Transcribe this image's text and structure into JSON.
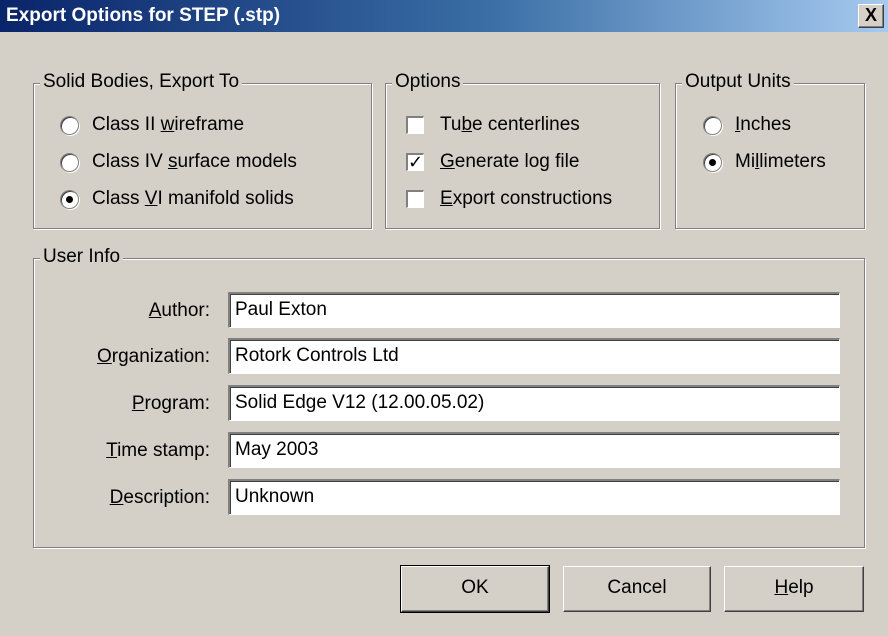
{
  "window": {
    "title": "Export Options for STEP (.stp)",
    "close_glyph": "X"
  },
  "solid_bodies": {
    "legend": "Solid Bodies, Export To",
    "options": [
      {
        "pre": "Class II ",
        "key": "w",
        "post": "ireframe",
        "selected": false
      },
      {
        "pre": "Class IV ",
        "key": "s",
        "post": "urface models",
        "selected": false
      },
      {
        "pre": "Class ",
        "key": "V",
        "post": "I manifold solids",
        "selected": true
      }
    ]
  },
  "options_group": {
    "legend": "Options",
    "items": [
      {
        "pre": "Tu",
        "key": "b",
        "post": "e centerlines",
        "checked": false
      },
      {
        "pre": "",
        "key": "G",
        "post": "enerate log file",
        "checked": true
      },
      {
        "pre": "",
        "key": "E",
        "post": "xport constructions",
        "checked": false
      }
    ]
  },
  "output_units": {
    "legend": "Output Units",
    "options": [
      {
        "pre": "",
        "key": "I",
        "post": "nches",
        "selected": false
      },
      {
        "pre": "Mi",
        "key": "l",
        "post": "limeters",
        "selected": true
      }
    ]
  },
  "user_info": {
    "legend": "User Info",
    "fields": [
      {
        "key": "A",
        "post": "uthor:",
        "value": "Paul Exton"
      },
      {
        "key": "O",
        "post": "rganization:",
        "value": "Rotork Controls Ltd"
      },
      {
        "key": "P",
        "post": "rogram:",
        "value": "Solid Edge V12 (12.00.05.02)"
      },
      {
        "key": "T",
        "post": "ime stamp:",
        "value": "May 2003"
      },
      {
        "key": "D",
        "post": "escription:",
        "value": "Unknown"
      }
    ]
  },
  "buttons": {
    "ok": "OK",
    "cancel": "Cancel",
    "help_key": "H",
    "help_post": "elp"
  }
}
